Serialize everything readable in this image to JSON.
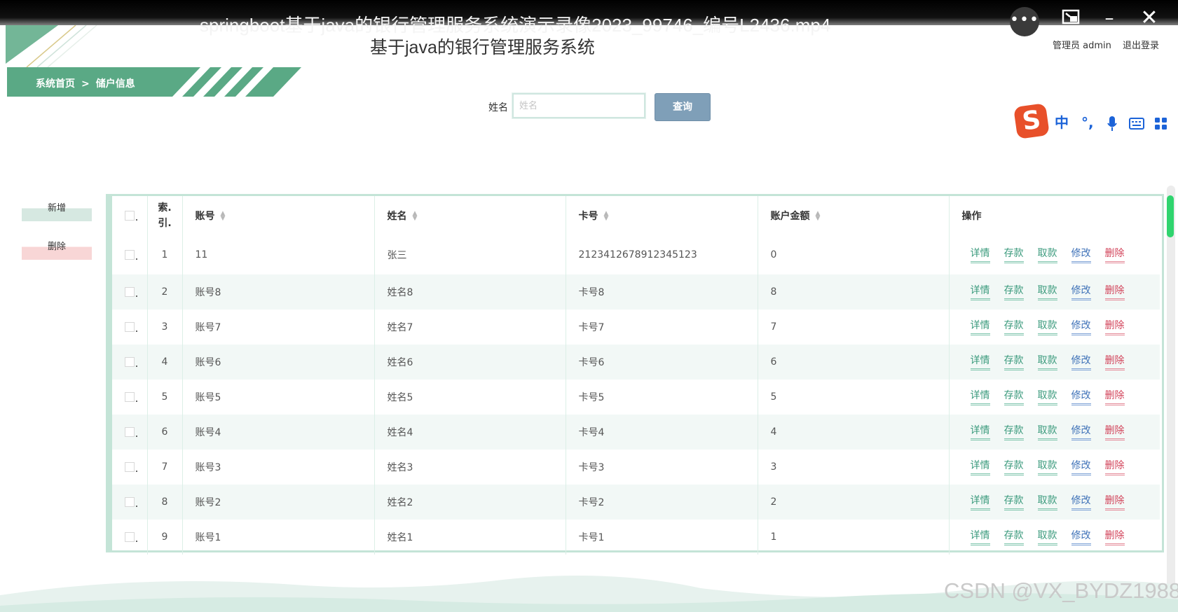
{
  "video": {
    "title": "springboot基于java的银行管理服务系统演示录像2023_99746_编号L2436.mp4",
    "more_icon": "more-icon",
    "window_icon": "picture-in-picture-icon",
    "minimize_icon": "minimize-icon",
    "close_icon": "close-icon"
  },
  "header": {
    "title": "基于java的银行管理服务系统",
    "user_label": "管理员 admin",
    "logout_label": "退出登录"
  },
  "breadcrumb": {
    "home": "系统首页",
    "separator": ">",
    "current": "储户信息"
  },
  "search": {
    "label": "姓名",
    "placeholder": "姓名",
    "value": "",
    "button_label": "查询"
  },
  "ime": {
    "logo": "S",
    "mode": "中",
    "punct": "°,",
    "mic_icon": "microphone-icon",
    "keyboard_icon": "keyboard-icon",
    "apps_icon": "apps-grid-icon"
  },
  "sidebar": {
    "add_label": "新增",
    "delete_label": "删除"
  },
  "table": {
    "headers": {
      "index": "索.\n引.",
      "account": "账号",
      "name": "姓名",
      "card": "卡号",
      "balance": "账户金额",
      "actions": "操作"
    },
    "action_labels": {
      "detail": "详情",
      "deposit": "存款",
      "withdraw": "取款",
      "edit": "修改",
      "delete": "删除"
    },
    "rows": [
      {
        "index": "1",
        "account": "11",
        "name": "张三",
        "card": "2123412678912345123",
        "balance": "0"
      },
      {
        "index": "2",
        "account": "账号8",
        "name": "姓名8",
        "card": "卡号8",
        "balance": "8"
      },
      {
        "index": "3",
        "account": "账号7",
        "name": "姓名7",
        "card": "卡号7",
        "balance": "7"
      },
      {
        "index": "4",
        "account": "账号6",
        "name": "姓名6",
        "card": "卡号6",
        "balance": "6"
      },
      {
        "index": "5",
        "account": "账号5",
        "name": "姓名5",
        "card": "卡号5",
        "balance": "5"
      },
      {
        "index": "6",
        "account": "账号4",
        "name": "姓名4",
        "card": "卡号4",
        "balance": "4"
      },
      {
        "index": "7",
        "account": "账号3",
        "name": "姓名3",
        "card": "卡号3",
        "balance": "3"
      },
      {
        "index": "8",
        "account": "账号2",
        "name": "姓名2",
        "card": "卡号2",
        "balance": "2"
      },
      {
        "index": "9",
        "account": "账号1",
        "name": "姓名1",
        "card": "卡号1",
        "balance": "1"
      }
    ]
  },
  "watermark": "CSDN @VX_BYDZ1988",
  "colors": {
    "brand_green": "#5aa985",
    "search_button": "#7f9fb8",
    "edit_blue": "#3f72b8",
    "delete_red": "#d2435a",
    "action_green": "#3a9a7c"
  }
}
